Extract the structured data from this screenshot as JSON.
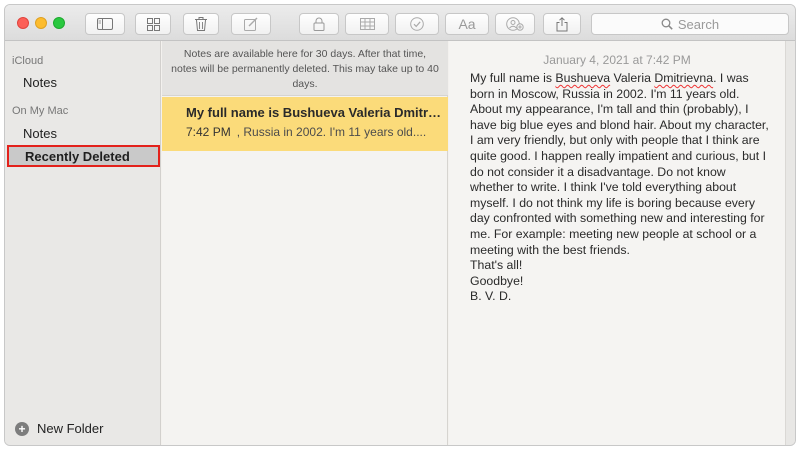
{
  "toolbar": {
    "search_placeholder": "Search",
    "format_label": "Aa",
    "icons": [
      "sidebar-toggle-icon",
      "gallery-view-icon",
      "trash-icon",
      "compose-icon",
      "lock-icon",
      "table-icon",
      "checklist-icon",
      "format-icon",
      "share-people-icon",
      "share-icon",
      "search-icon"
    ]
  },
  "sidebar": {
    "section_icloud": "iCloud",
    "icloud_notes": "Notes",
    "section_mac": "On My Mac",
    "mac_notes": "Notes",
    "recently_deleted": "Recently Deleted",
    "new_folder": "New Folder"
  },
  "notes_list": {
    "notice": "Notes are available here for 30 days. After that time, notes will be permanently deleted. This may take up to 40 days.",
    "items": [
      {
        "title": "My full name is Bushueva Valeria Dmitrievna.",
        "time": "7:42 PM",
        "preview": ", Russia in 2002. I'm 11 years old...."
      }
    ]
  },
  "editor": {
    "date": "January 4, 2021 at 7:42 PM",
    "body": {
      "p1_a": "My full name is ",
      "p1_name1": "Bushueva",
      "p1_b": " Valeria ",
      "p1_name2": "Dmitrievna",
      "p1_c": ". I was born in Moscow, Russia in 2002. I'm 11 years old. About my appearance, I'm tall and thin (probably), I have big blue eyes and blond hair. About my character, I am very friendly, but only with people that I think are quite good. I happen really impatient and curious, but I do not consider it a disadvantage. Do not know whether to write. I think I've told everything about myself. I do not think my life is boring because every day confronted with something new and interesting for me. For example: meeting new people at school or a meeting with the best friends.",
      "line2": "That's all!",
      "line3": "Goodbye!",
      "line4": "B. V. D."
    }
  },
  "colors": {
    "selected_note": "#fbdb7a",
    "highlight_border": "#e3211b",
    "selected_sidebar": "#c9c9c9"
  }
}
